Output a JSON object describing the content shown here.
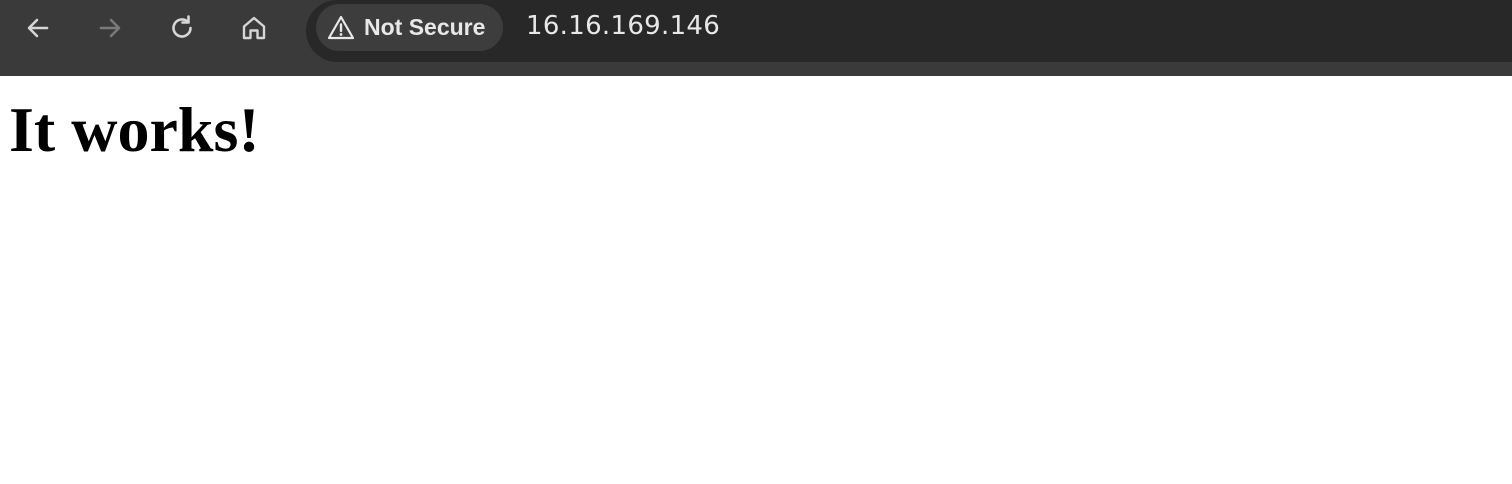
{
  "browser": {
    "nav": {
      "back_icon": "arrow-left-icon",
      "forward_icon": "arrow-right-icon",
      "reload_icon": "reload-icon",
      "home_icon": "home-icon"
    },
    "address_bar": {
      "security_label": "Not Secure",
      "security_icon": "warning-triangle-icon",
      "url": "16.16.169.146"
    },
    "colors": {
      "toolbar_bg": "#3a3a3a",
      "address_bg": "#282828",
      "chip_bg": "#3d3d3d",
      "icon_active": "#d6d6d6",
      "icon_disabled": "#7a7a7a",
      "text": "#e8e8e8"
    }
  },
  "page": {
    "heading": "It works!"
  }
}
